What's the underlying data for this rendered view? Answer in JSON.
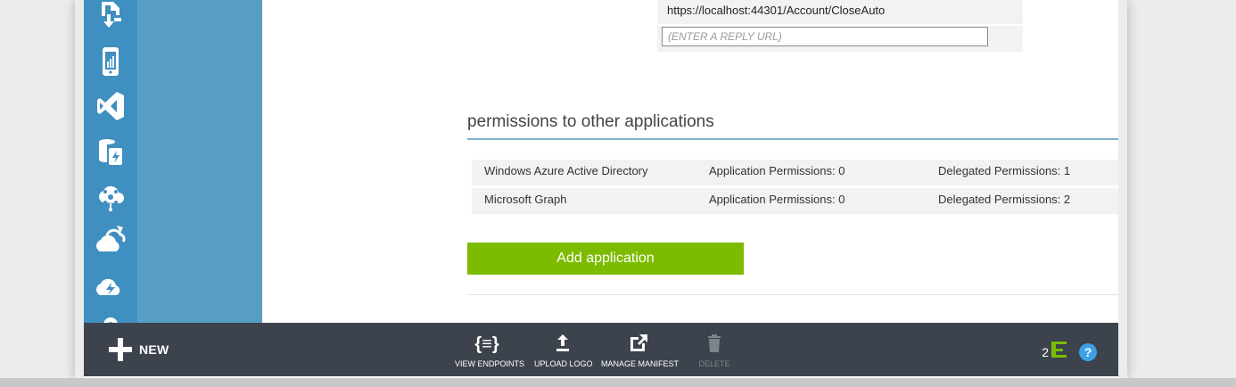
{
  "reply_urls": {
    "existing": "https://localhost:44301/Account/CloseAuto",
    "new_placeholder": "(ENTER A REPLY URL)"
  },
  "permissions": {
    "title": "permissions to other applications",
    "help": "?",
    "rows": [
      {
        "app": "Windows Azure Active Directory",
        "application": "Application Permissions: 0",
        "delegated": "Delegated Permissions: 1"
      },
      {
        "app": "Microsoft Graph",
        "application": "Application Permissions: 0",
        "delegated": "Delegated Permissions: 2"
      }
    ],
    "add_button": "Add application"
  },
  "nav_icons": [
    "sql-database-icon",
    "mobile-service-icon",
    "visual-studio-icon",
    "storage-icon",
    "service-bus-icon",
    "cloud-service-icon",
    "azure-cloud-icon",
    "more-icon"
  ],
  "command_bar": {
    "new_label": "NEW",
    "view_endpoints": "VIEW ENDPOINTS",
    "upload_logo": "UPLOAD LOGO",
    "manage_manifest": "MANAGE MANIFEST",
    "delete": "DELETE",
    "notification_count": "2",
    "help": "?"
  },
  "colors": {
    "rail": "#3f8fc0",
    "subnav": "#569fc3",
    "accent_green": "#7cbb00",
    "command_bar": "#3c434c",
    "help_blue": "#3ba0e8",
    "notification_green": "#7cbb00"
  }
}
